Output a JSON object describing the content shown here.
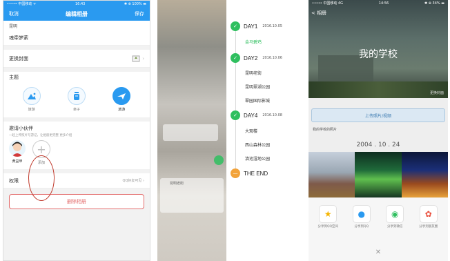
{
  "panel1": {
    "status": {
      "carrier": "••••• 中国移动 ᯤ",
      "time": "16:43",
      "battery": "✱ ⊕ 100% ▬"
    },
    "nav": {
      "cancel": "取消",
      "title": "编辑相册",
      "save": "保存"
    },
    "name_label": "昆明",
    "album_name": "魂牵梦萦",
    "cover_label": "更换封面",
    "theme_label": "主题",
    "themes": [
      {
        "label": "旅游",
        "icon": "landscape-icon"
      },
      {
        "label": "亲子",
        "icon": "baby-bottle-icon"
      },
      {
        "label": "旅游",
        "icon": "airplane-icon"
      }
    ],
    "partner_label": "邀请小伙伴",
    "partner_hint": "一起上传照片写游记，让相册更完整 更多介绍",
    "partner_name": "黄益甲",
    "add_label": "添加",
    "permission_label": "权限",
    "permission_value": "QQ好友可见 ›",
    "delete_label": "删除相册"
  },
  "panel2": {
    "days": [
      {
        "title": "DAY1",
        "date": "2016.10.05",
        "spots": [
          "金马碧鸡"
        ]
      },
      {
        "title": "DAY2",
        "date": "2016.10.06",
        "spots": [
          "昆明老街",
          "昆明翠湖公园",
          "翠园国际影城"
        ]
      },
      {
        "title": "DAY4",
        "date": "2016.10.08",
        "spots": [
          "大观楼",
          "西山森林公园",
          "滇池湿地公园"
        ]
      }
    ],
    "end_label": "THE END",
    "blur_text": "昆明老街"
  },
  "panel3": {
    "status": {
      "carrier": "••••• 中国移动 4G",
      "time": "14:56",
      "battery": "✱ ⊕ 34% ▬"
    },
    "back": "< 相册",
    "cover_title": "我的学校",
    "cover_link": "更换封面",
    "upload": "上传照片/视频",
    "album_caption": "我的学校的照片",
    "album_date": "2004 . 10 . 24",
    "share": [
      {
        "label": "分享到QQ空间",
        "icon": "qzone-star-icon",
        "glyph": "★",
        "color": "#f5b400"
      },
      {
        "label": "分享到QQ",
        "icon": "qq-person-icon",
        "glyph": "●",
        "color": "#2a9af0"
      },
      {
        "label": "分享到微信",
        "icon": "wechat-icon",
        "glyph": "◉",
        "color": "#2fbf5f"
      },
      {
        "label": "分享到朋友圈",
        "icon": "moments-icon",
        "glyph": "✿",
        "color": "#e94f3d"
      }
    ],
    "close": "✕"
  }
}
